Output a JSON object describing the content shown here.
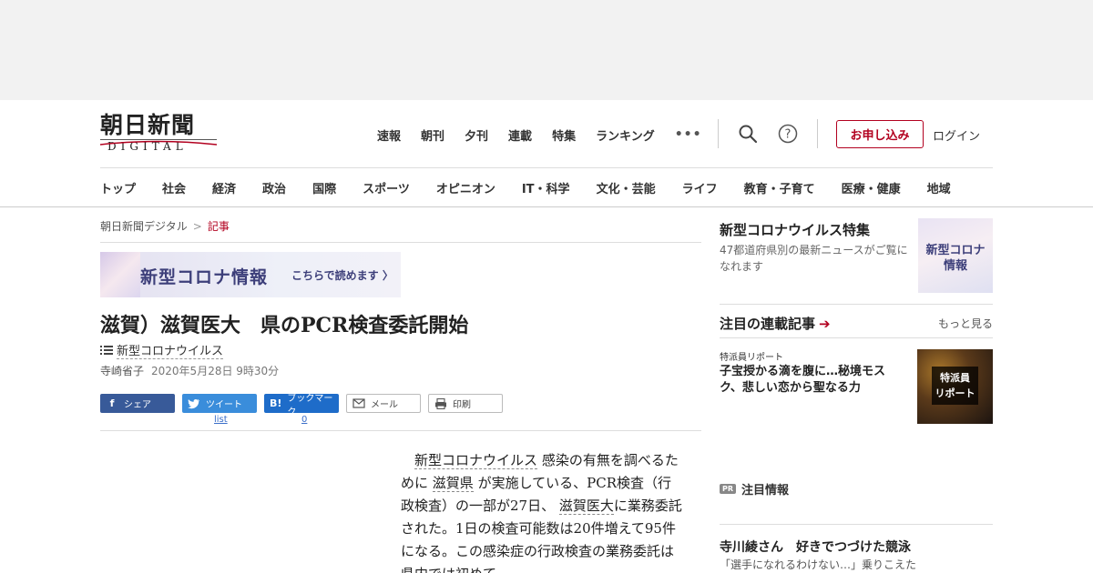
{
  "header": {
    "logo_text": "朝日新聞",
    "logo_sub": "DIGITAL",
    "topnav": [
      "速報",
      "朝刊",
      "夕刊",
      "連載",
      "特集",
      "ランキング"
    ],
    "more_label": "•••",
    "signup_label": "お申し込み",
    "login_label": "ログイン"
  },
  "categories": [
    "トップ",
    "社会",
    "経済",
    "政治",
    "国際",
    "スポーツ",
    "オピニオン",
    "IT・科学",
    "文化・芸能",
    "ライフ",
    "教育・子育て",
    "医療・健康",
    "地域"
  ],
  "breadcrumb": {
    "home": "朝日新聞デジタル",
    "sep": ">",
    "current": "記事"
  },
  "banner": {
    "title": "新型コロナ情報",
    "link": "こちらで読めます"
  },
  "article": {
    "headline": "滋賀）滋賀医大　県のPCR検査委託開始",
    "tag": "新型コロナウイルス",
    "author": "寺崎省子",
    "date": "2020年5月28日 9時30分",
    "body": {
      "link1": "新型コロナウイルス",
      "t1": "感染の有無を調べるために",
      "link2": "滋賀県",
      "t2": "が実施している、PCR検査（行政検査）の一部が27日、",
      "link3": "滋賀医大",
      "t3": "に業務委託された。1日の検査可能数は20件増えて95件になる。この感染症の行政検査の業務委託は県内では初めて。"
    }
  },
  "share": {
    "facebook": "シェア",
    "twitter": "ツイート",
    "hatena": "ブックマーク",
    "mail": "メール",
    "print": "印刷",
    "twitter_count": "list",
    "hatena_count": "0"
  },
  "sidebar": {
    "feature_title": "新型コロナウイルス特集",
    "feature_desc": "47都道府県別の最新ニュースがご覧になれます",
    "feature_thumb_text": "新型コロナ\n情報",
    "series_title": "注目の連載記事",
    "series_more": "もっと見る",
    "series_tag": "特派員リポート",
    "series_headline": "子宝授かる滴を腹に…秘境モスク、悲しい恋から聖なる力",
    "series_thumb_text": "特派員\nリポート",
    "pr_badge": "PR",
    "pr_label": "注目情報",
    "pr_headline": "寺川綾さん　好きでつづけた競泳",
    "pr_desc": "「選手になれるわけない…」乗りこえた"
  },
  "colors": {
    "brand_red": "#b2001f",
    "corona_purple": "#3d3f7a",
    "facebook": "#385a99",
    "twitter": "#3a8ddb",
    "hatena": "#1e6cc9"
  }
}
